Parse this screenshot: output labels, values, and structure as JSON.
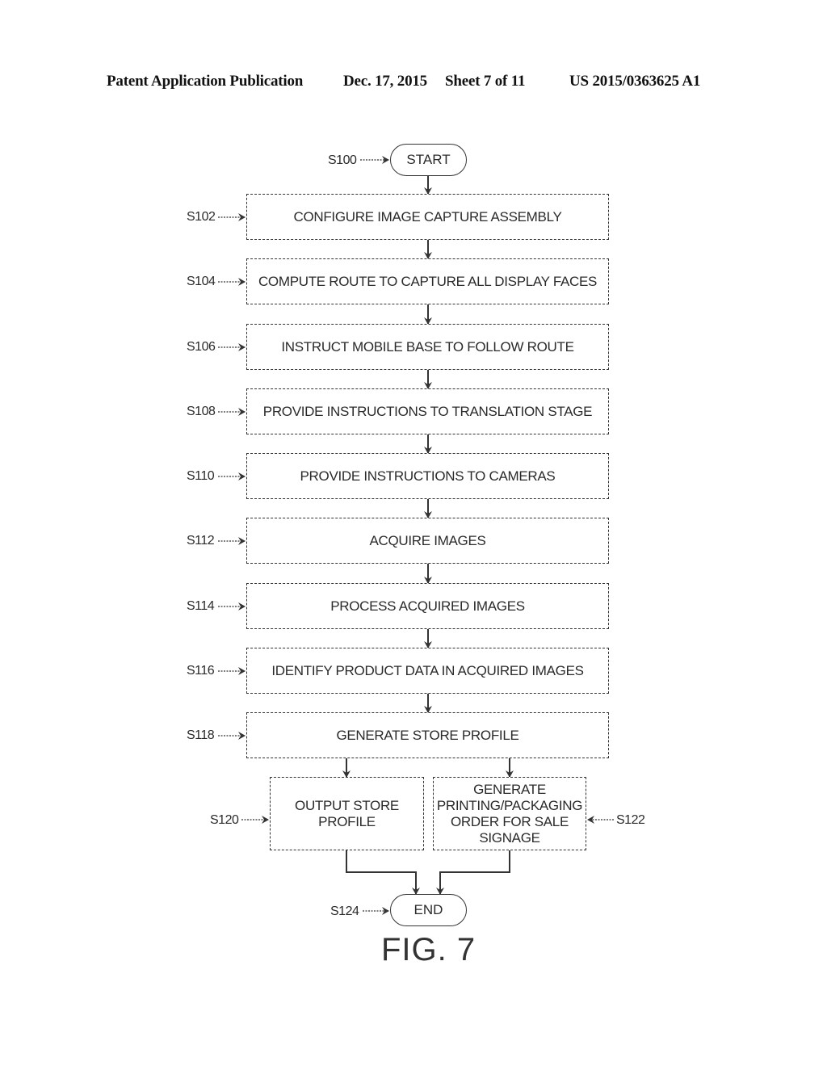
{
  "header": {
    "publication": "Patent Application Publication",
    "date": "Dec. 17, 2015",
    "sheet": "Sheet 7 of 11",
    "number": "US 2015/0363625 A1"
  },
  "flowchart": {
    "start": {
      "ref": "S100",
      "label": "START"
    },
    "steps": [
      {
        "ref": "S102",
        "label": "CONFIGURE IMAGE CAPTURE ASSEMBLY"
      },
      {
        "ref": "S104",
        "label": "COMPUTE ROUTE TO CAPTURE ALL DISPLAY FACES"
      },
      {
        "ref": "S106",
        "label": "INSTRUCT MOBILE BASE TO FOLLOW ROUTE"
      },
      {
        "ref": "S108",
        "label": "PROVIDE INSTRUCTIONS TO TRANSLATION STAGE"
      },
      {
        "ref": "S110",
        "label": "PROVIDE INSTRUCTIONS TO CAMERAS"
      },
      {
        "ref": "S112",
        "label": "ACQUIRE IMAGES"
      },
      {
        "ref": "S114",
        "label": "PROCESS ACQUIRED IMAGES"
      },
      {
        "ref": "S116",
        "label": "IDENTIFY PRODUCT DATA IN ACQUIRED IMAGES"
      },
      {
        "ref": "S118",
        "label": "GENERATE STORE PROFILE"
      }
    ],
    "branch_left": {
      "ref": "S120",
      "lines": [
        "OUTPUT STORE",
        "PROFILE"
      ]
    },
    "branch_right": {
      "ref": "S122",
      "lines": [
        "GENERATE",
        "PRINTING/PACKAGING",
        "ORDER FOR SALE",
        "SIGNAGE"
      ]
    },
    "end": {
      "ref": "S124",
      "label": "END"
    }
  },
  "figure_label": "FIG. 7"
}
